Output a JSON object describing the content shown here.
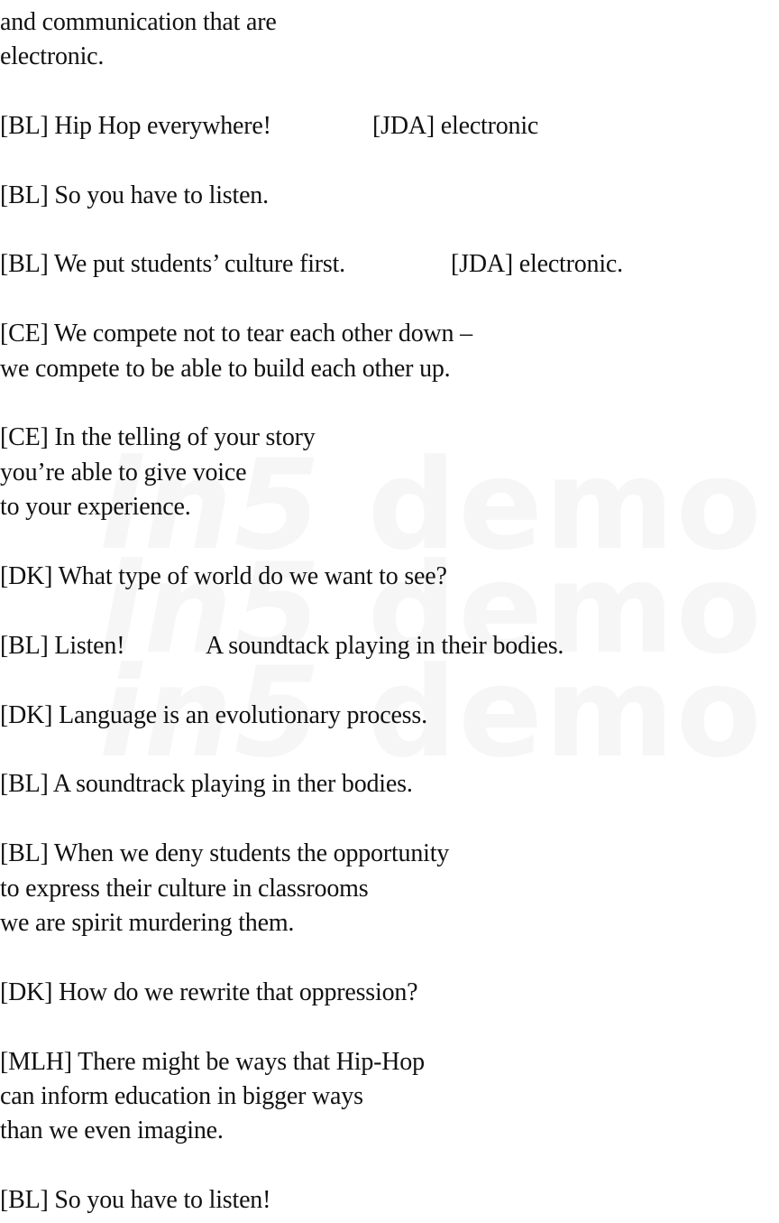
{
  "lines": [
    "and communication that are",
    "electronic.",
    "[BL] Hip Hop everywhere!",
    "[JDA] electronic",
    "[BL] So you have to listen.",
    "[BL] We put students’ culture first.",
    "[JDA] electronic.",
    "[CE] We compete not to tear each other down –",
    "we compete to be able to build each other up.",
    "[CE] In the telling of your story",
    "you’re able to give voice",
    "to your experience.",
    "[DK] What type of world do we want to see?",
    "[BL] Listen!",
    "A soundtack playing in their bodies.",
    "[DK] Language is an evolutionary process.",
    "[BL] A soundtrack playing in ther bodies.",
    "[BL] When we deny students the opportunity",
    "to express their culture in classrooms",
    "we are spirit murdering them.",
    "[DK] How do we rewrite that oppression?",
    "[MLH] There might be ways that Hip-Hop",
    "can inform education in bigger ways",
    "than we even imagine.",
    "[BL] So you have to listen!"
  ],
  "watermark": {
    "prefix": "in5",
    "word": " demo"
  }
}
